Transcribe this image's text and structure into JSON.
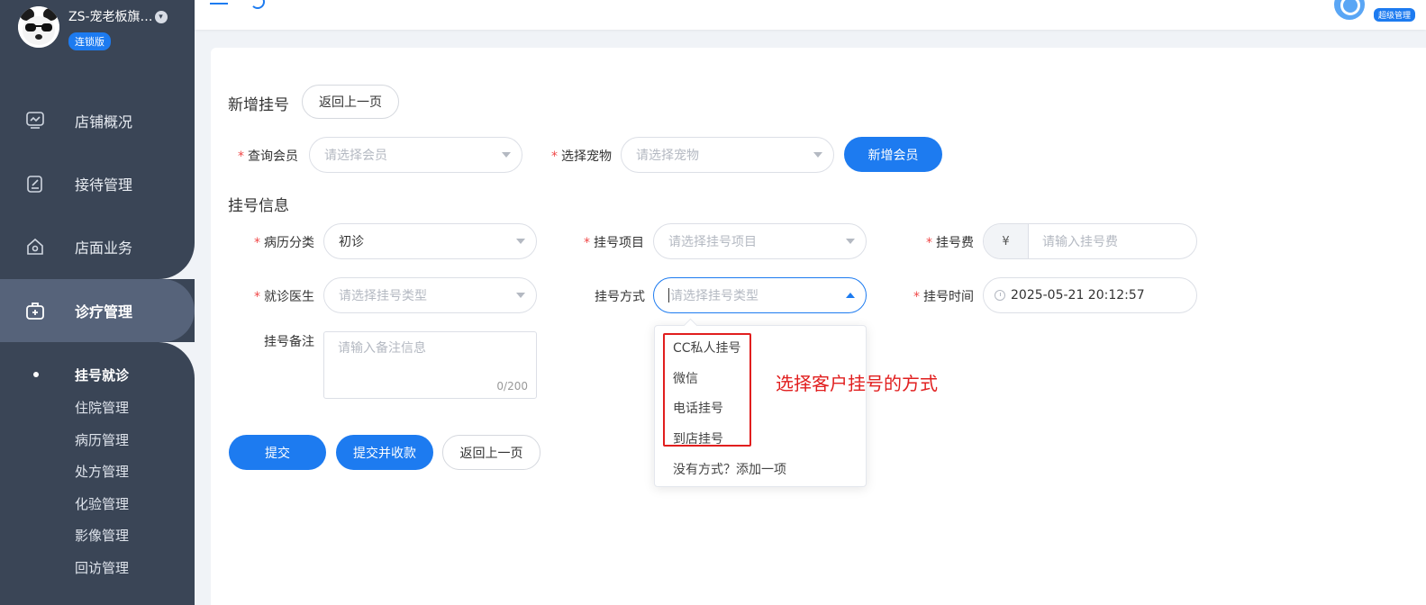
{
  "sidebar": {
    "shop_name": "ZS-宠老板旗…",
    "shop_badge": "连锁版",
    "nav": [
      {
        "label": "店铺概况",
        "icon": "dashboard-icon"
      },
      {
        "label": "接待管理",
        "icon": "reception-icon"
      },
      {
        "label": "店面业务",
        "icon": "store-icon"
      },
      {
        "label": "诊疗管理",
        "icon": "medical-kit-icon"
      }
    ],
    "sub": [
      "挂号就诊",
      "住院管理",
      "病历管理",
      "处方管理",
      "化验管理",
      "影像管理",
      "回访管理"
    ]
  },
  "topbar": {
    "role_badge": "超级管理"
  },
  "page": {
    "title": "新增挂号",
    "back_label": "返回上一页",
    "section_title": "挂号信息"
  },
  "member": {
    "member_label": "查询会员",
    "member_placeholder": "请选择会员",
    "pet_label": "选择宠物",
    "pet_placeholder": "请选择宠物",
    "add_member_label": "新增会员"
  },
  "form": {
    "record_type_label": "病历分类",
    "record_type_value": "初诊",
    "project_label": "挂号项目",
    "project_placeholder": "请选择挂号项目",
    "fee_label": "挂号费",
    "fee_prefix": "¥",
    "fee_placeholder": "请输入挂号费",
    "doctor_label": "就诊医生",
    "doctor_placeholder": "请选择挂号类型",
    "method_label": "挂号方式",
    "method_placeholder": "请选择挂号类型",
    "time_label": "挂号时间",
    "time_value": "2025-05-21 20:12:57",
    "note_label": "挂号备注",
    "note_placeholder": "请输入备注信息",
    "note_counter": "0/200"
  },
  "dropdown": {
    "options": [
      "CC私人挂号",
      "微信",
      "电话挂号",
      "到店挂号"
    ],
    "add_option": "没有方式？添加一项"
  },
  "annotation": "选择客户挂号的方式",
  "actions": {
    "submit": "提交",
    "submit_pay": "提交并收款",
    "back": "返回上一页"
  },
  "colors": {
    "primary": "#1d7bf0",
    "sidebar": "#3a4556",
    "annotation": "#e11e1e"
  }
}
